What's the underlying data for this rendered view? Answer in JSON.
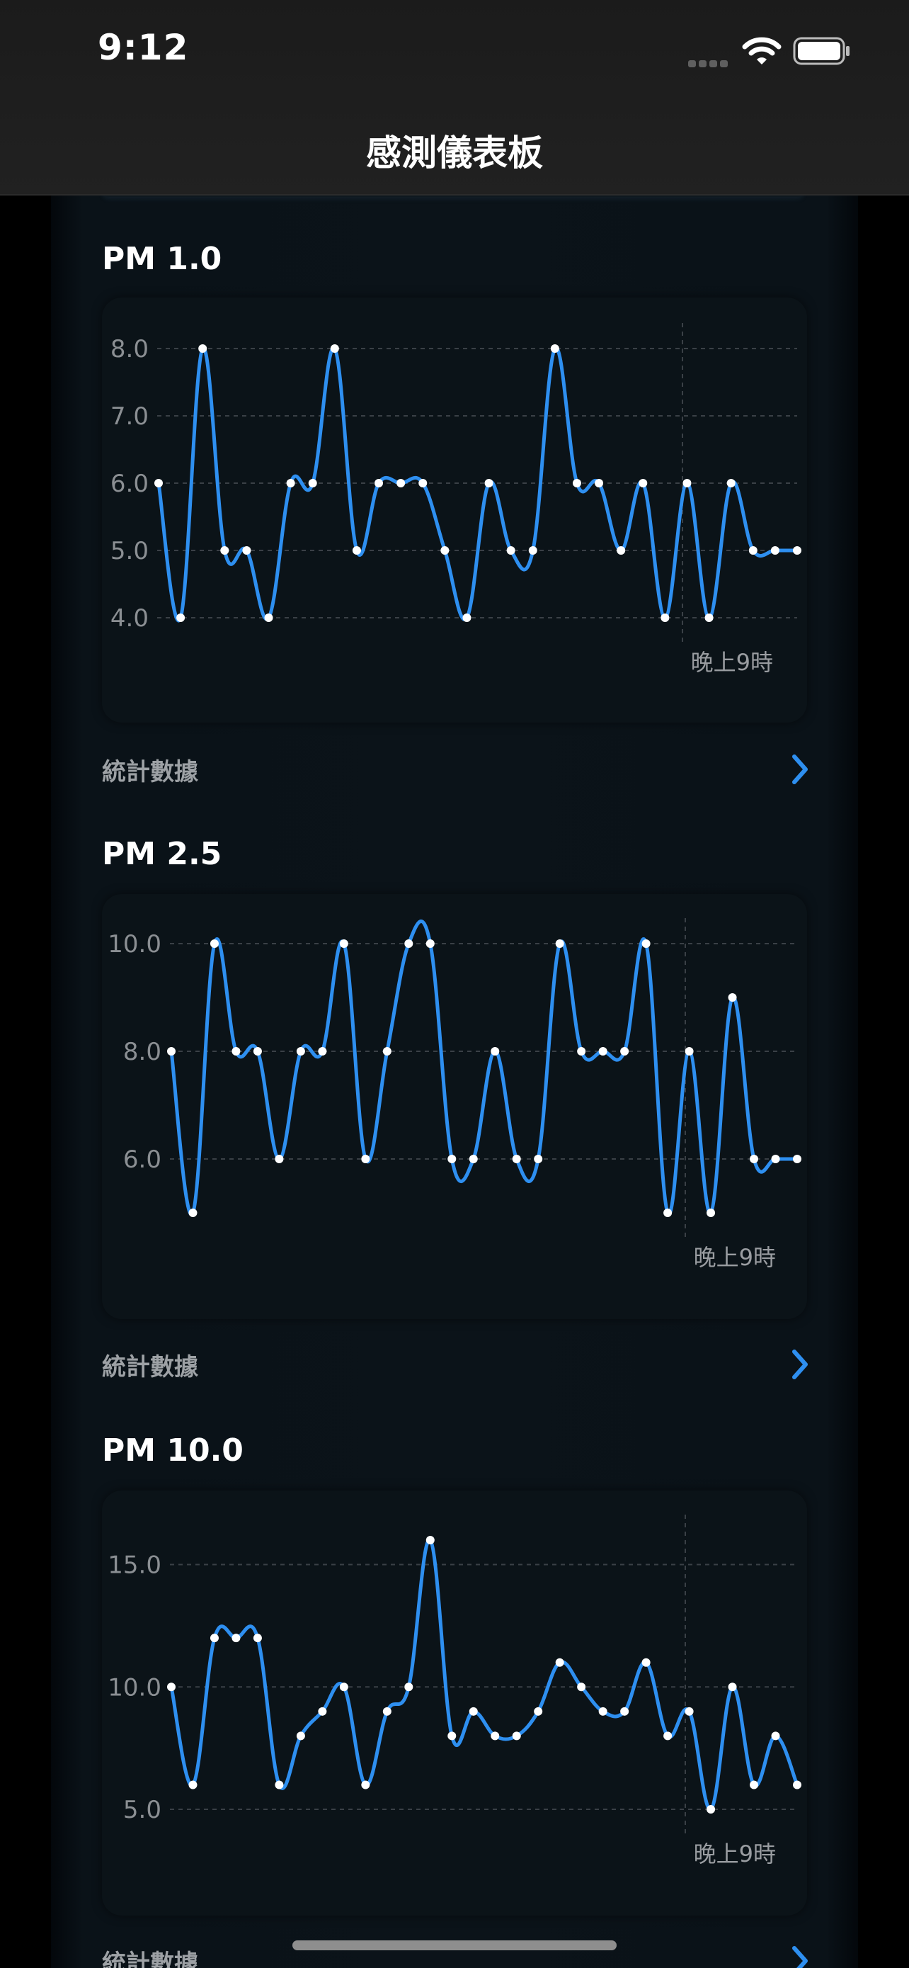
{
  "status_bar": {
    "time": "9:12"
  },
  "header": {
    "title": "感測儀表板"
  },
  "colors": {
    "accent": "#2e8ff0",
    "point": "#ffffff",
    "grid": "#3a3f44",
    "background": "#0b1318"
  },
  "sections": [
    {
      "title": "PM 1.0",
      "stats_label": "統計數據",
      "time_label": "晚上9時"
    },
    {
      "title": "PM 2.5",
      "stats_label": "統計數據",
      "time_label": "晚上9時"
    },
    {
      "title": "PM 10.0",
      "stats_label": "統計數據",
      "time_label": "晚上9時"
    }
  ],
  "chart_data": [
    {
      "type": "line",
      "title": "PM 1.0",
      "y_ticks": [
        "8.0",
        "7.0",
        "6.0",
        "5.0",
        "4.0"
      ],
      "ylim": [
        4,
        8
      ],
      "x_label": "晚上9時",
      "values": [
        6,
        4,
        8,
        5,
        5,
        4,
        6,
        6,
        8,
        5,
        6,
        6,
        6,
        5,
        4,
        6,
        5,
        5,
        8,
        6,
        6,
        5,
        6,
        4,
        6,
        4,
        6,
        5,
        5,
        5
      ]
    },
    {
      "type": "line",
      "title": "PM 2.5",
      "y_ticks": [
        "10.0",
        "8.0",
        "6.0"
      ],
      "ylim": [
        5,
        10
      ],
      "x_label": "晚上9時",
      "values": [
        8,
        5,
        10,
        8,
        8,
        6,
        8,
        8,
        10,
        6,
        8,
        10,
        10,
        6,
        6,
        8,
        6,
        6,
        10,
        8,
        8,
        8,
        10,
        5,
        8,
        5,
        9,
        6,
        6,
        6
      ]
    },
    {
      "type": "line",
      "title": "PM 10.0",
      "y_ticks": [
        "15.0",
        "10.0",
        "5.0"
      ],
      "ylim": [
        5,
        16
      ],
      "x_label": "晚上9時",
      "values": [
        10,
        6,
        12,
        12,
        12,
        6,
        8,
        9,
        10,
        6,
        9,
        10,
        16,
        8,
        9,
        8,
        8,
        9,
        11,
        10,
        9,
        9,
        11,
        8,
        9,
        5,
        10,
        6,
        8,
        6
      ]
    }
  ]
}
